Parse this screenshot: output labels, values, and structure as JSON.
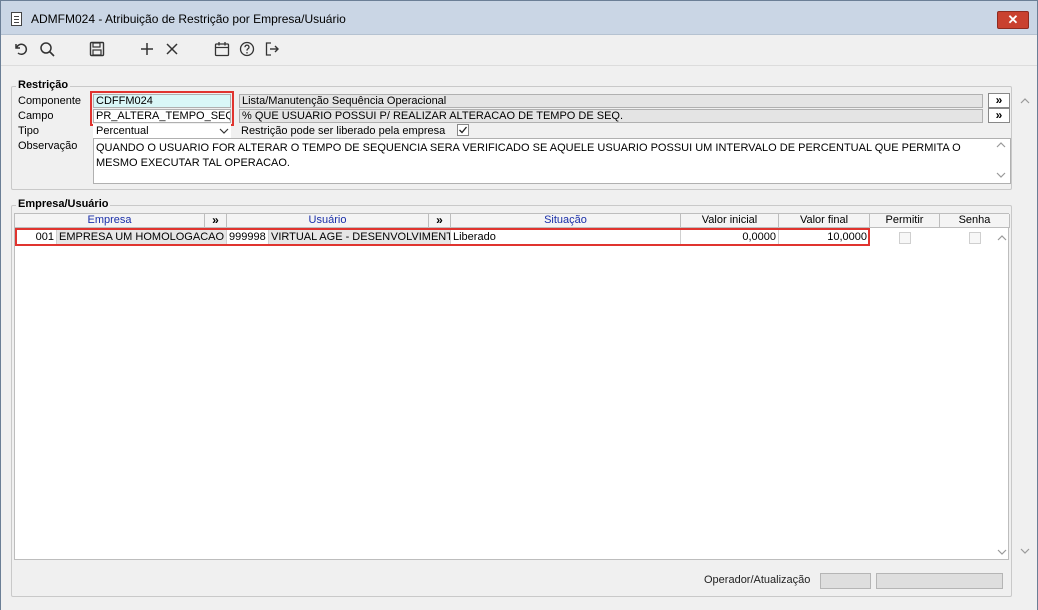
{
  "window": {
    "title": "ADMFM024 - Atribuição de Restrição por Empresa/Usuário",
    "close_glyph": "✕"
  },
  "toolbar": {
    "icons": [
      "refresh-icon",
      "search-icon",
      "save-icon",
      "add-icon",
      "delete-icon",
      "calendar-icon",
      "help-icon",
      "exit-icon"
    ]
  },
  "restricao": {
    "group_title": "Restrição",
    "componente_label": "Componente",
    "componente_value": "CDFFM024",
    "componente_desc": "Lista/Manutenção Sequência Operacional",
    "campo_label": "Campo",
    "campo_value": "PR_ALTERA_TEMPO_SEQ",
    "campo_desc": "% QUE USUARIO POSSUI P/ REALIZAR ALTERACAO DE TEMPO DE SEQ.",
    "tipo_label": "Tipo",
    "tipo_value": "Percentual",
    "liberado_label": "Restrição pode ser liberado pela empresa",
    "liberado_checked": true,
    "observacao_label": "Observação",
    "observacao_value": "QUANDO O USUARIO FOR ALTERAR O TEMPO DE SEQUENCIA SERA VERIFICADO SE AQUELE USUARIO POSSUI UM INTERVALO DE PERCENTUAL QUE PERMITA O MESMO EXECUTAR TAL OPERACAO.",
    "lookup_glyph": "»"
  },
  "empresa_usuario": {
    "group_title": "Empresa/Usuário",
    "columns": {
      "empresa": "Empresa",
      "usuario": "Usuário",
      "situacao": "Situação",
      "valor_inicial": "Valor inicial",
      "valor_final": "Valor final",
      "permitir": "Permitir",
      "senha": "Senha"
    },
    "rows": [
      {
        "empresa_code": "001",
        "empresa_name": "EMPRESA UM HOMOLOGACAO",
        "usuario_code": "999998",
        "usuario_name": "VIRTUAL AGE - DESENVOLVIMENTO",
        "situacao": "Liberado",
        "valor_inicial": "0,0000",
        "valor_final": "10,0000",
        "permitir": false,
        "senha": false
      }
    ]
  },
  "status": {
    "operador_label": "Operador/Atualização"
  },
  "colors": {
    "highlight_red": "#e0342f",
    "header_blue": "#1a2fa8",
    "key_field_cyan": "#d9f7f7"
  }
}
